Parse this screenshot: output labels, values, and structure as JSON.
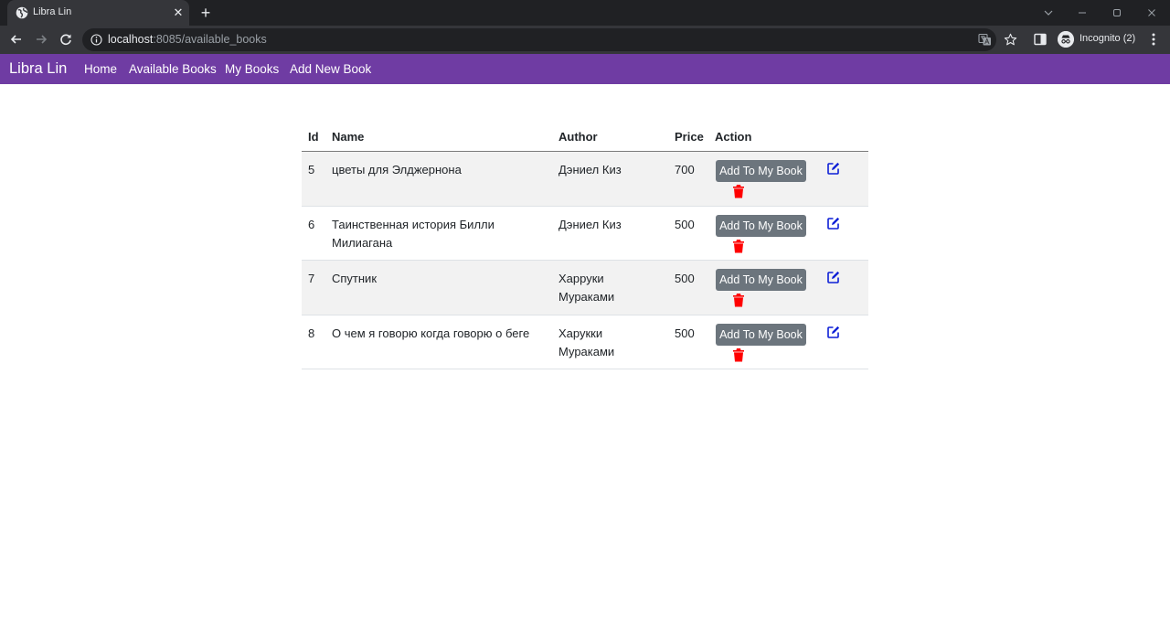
{
  "browser": {
    "tab_title": "Libra Lin",
    "url_host": "localhost",
    "url_rest": ":8085/available_books",
    "profile_label": "Incognito (2)"
  },
  "navbar": {
    "brand": "Libra Lin",
    "links": [
      "Home",
      "Available Books",
      "My Books",
      "Add New Book"
    ],
    "color": "#6f3ca3"
  },
  "table": {
    "headers": {
      "id": "Id",
      "name": "Name",
      "author": "Author",
      "price": "Price",
      "action": "Action"
    },
    "add_label": "Add To My Book",
    "rows": [
      {
        "id": "5",
        "name": "цветы для Элджернона",
        "author": "Дэниел Киз",
        "price": "700"
      },
      {
        "id": "6",
        "name": "Таинственная история Билли Милиагана",
        "author": "Дэниел Киз",
        "price": "500"
      },
      {
        "id": "7",
        "name": "Спутник",
        "author": "Харруки Мураками",
        "price": "500"
      },
      {
        "id": "8",
        "name": "О чем я говорю когда говорю о беге",
        "author": "Харукки Мураками",
        "price": "500"
      }
    ]
  },
  "colors": {
    "delete": "#ff0000",
    "edit": "#0d1fd6",
    "button": "#6c757d"
  },
  "icons": [
    "globe-icon",
    "close-icon",
    "plus-icon",
    "back-icon",
    "forward-icon",
    "reload-icon",
    "info-icon",
    "translate-icon",
    "star-icon",
    "side-panel-icon",
    "incognito-icon",
    "kebab-menu-icon",
    "trash-icon",
    "edit-icon"
  ]
}
